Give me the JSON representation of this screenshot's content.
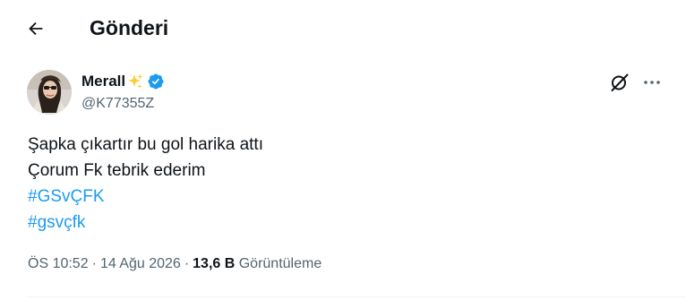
{
  "header": {
    "back_icon": "arrow-left-icon",
    "title": "Gönderi"
  },
  "tweet": {
    "author": {
      "display_name": "Merall",
      "name_emoji": "sparkles-icon",
      "verified_icon": "verified-badge-icon",
      "handle": "@K77355Z"
    },
    "actions": {
      "grok_icon": "grok-icon",
      "more_icon": "more-horizontal-icon"
    },
    "text_lines": [
      "Şapka çıkartır bu gol harika attı",
      "Çorum Fk tebrik ederim"
    ],
    "hashtags": [
      "#GSvÇFK",
      "#gsvçfk"
    ],
    "meta": {
      "time": "ÖS 10:52",
      "date": "14 Ağu 2026",
      "separator": "·",
      "views_count": "13,6 B",
      "views_label": "Görüntüleme"
    }
  },
  "colors": {
    "accent": "#1d9bf0",
    "text_primary": "#0f1419",
    "text_secondary": "#536471",
    "divider": "#eff3f4"
  }
}
